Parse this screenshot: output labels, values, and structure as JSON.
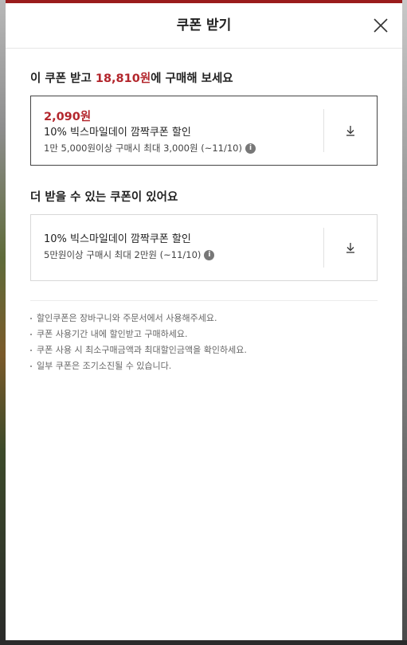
{
  "modal": {
    "title": "쿠폰 받기",
    "close_icon": "close-icon"
  },
  "best_section": {
    "title_prefix": "이 쿠폰 받고 ",
    "title_price": "18,810원",
    "title_suffix": "에 구매해 보세요"
  },
  "best_coupon": {
    "discount": "2,090원",
    "name": "10% 빅스마일데이 깜짝쿠폰 할인",
    "condition": "1만 5,000원이상 구매시 최대 3,000원 (~11/10)",
    "info_icon": "info-icon",
    "download_icon": "download-icon"
  },
  "more_section": {
    "title": "더 받을 수 있는 쿠폰이 있어요"
  },
  "more_coupon": {
    "name": "10% 빅스마일데이 깜짝쿠폰 할인",
    "condition": "5만원이상 구매시 최대 2만원 (~11/10)",
    "info_icon": "info-icon",
    "download_icon": "download-icon"
  },
  "notes": [
    "할인쿠폰은 장바구니와 주문서에서 사용해주세요.",
    "쿠폰 사용기간 내에 할인받고 구매하세요.",
    "쿠폰 사용 시 최소구매금액과 최대할인금액을 확인하세요.",
    "일부 쿠폰은 조기소진될 수 있습니다."
  ],
  "colors": {
    "accent": "#b3272d",
    "text": "#222222",
    "muted": "#666666"
  }
}
